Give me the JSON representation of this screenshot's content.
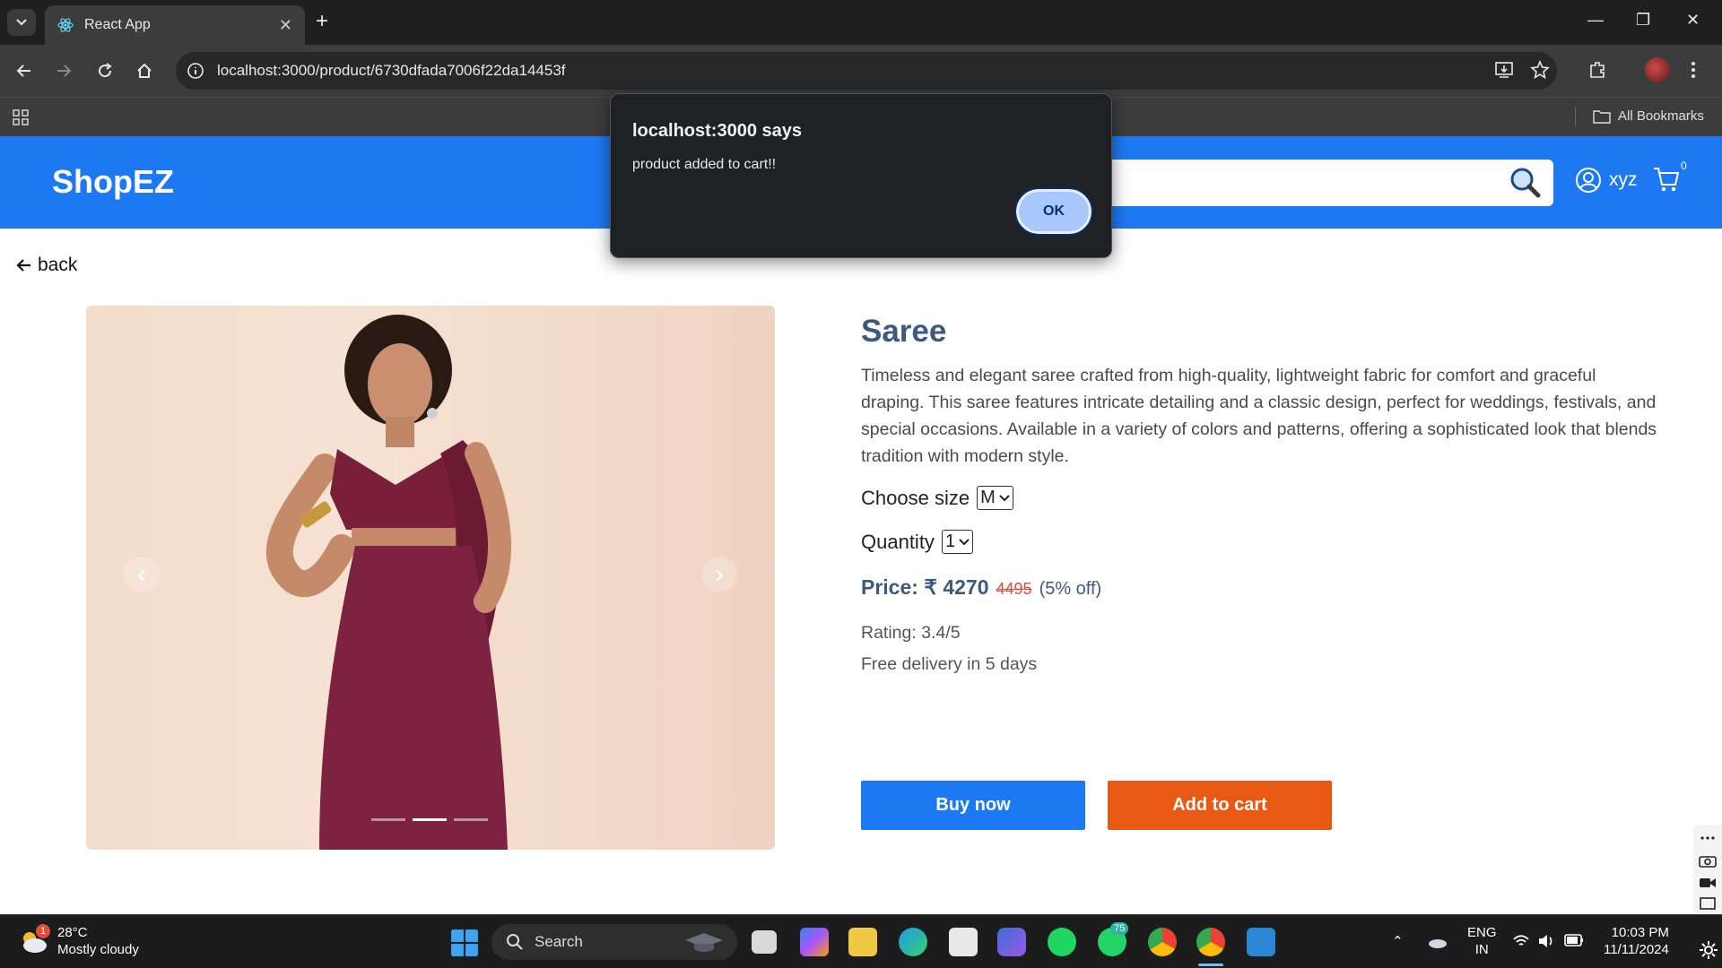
{
  "browser": {
    "tab_title": "React App",
    "url": "localhost:3000/product/6730dfada7006f22da14453f",
    "all_bookmarks_label": "All Bookmarks"
  },
  "header": {
    "brand": "ShopEZ",
    "search_placeholder": "",
    "username": "xyz",
    "cart_count": "0"
  },
  "page": {
    "back_label": "back"
  },
  "product": {
    "title": "Saree",
    "description": "Timeless and elegant saree crafted from high-quality, lightweight fabric for comfort and graceful draping. This saree features intricate detailing and a classic design, perfect for weddings, festivals, and special occasions. Available in a variety of colors and patterns, offering a sophisticated look that blends tradition with modern style.",
    "size_label": "Choose size",
    "size_value": "M",
    "quantity_label": "Quantity",
    "quantity_value": "1",
    "price_label": "Price: ₹ 4270",
    "old_price": "4495",
    "discount": "(5% off)",
    "rating": "Rating: 3.4/5",
    "delivery": "Free delivery in 5 days",
    "buy_now_label": "Buy now",
    "add_to_cart_label": "Add to cart",
    "carousel_slide_active": 2,
    "carousel_slides": 3
  },
  "dialog": {
    "title": "localhost:3000 says",
    "message": "product added to cart!!",
    "ok_label": "OK"
  },
  "taskbar": {
    "weather_temp": "28°C",
    "weather_desc": "Mostly cloudy",
    "weather_badge": "1",
    "search_label": "Search",
    "whatsapp_badge": "75",
    "lang_line1": "ENG",
    "lang_line2": "IN",
    "time": "10:03 PM",
    "date": "11/11/2024"
  },
  "colors": {
    "header_blue": "#1d79f2",
    "buy_button": "#1d79f2",
    "cart_button": "#e85a14",
    "title_text": "#3c5a80",
    "old_price": "#e64a3c"
  }
}
